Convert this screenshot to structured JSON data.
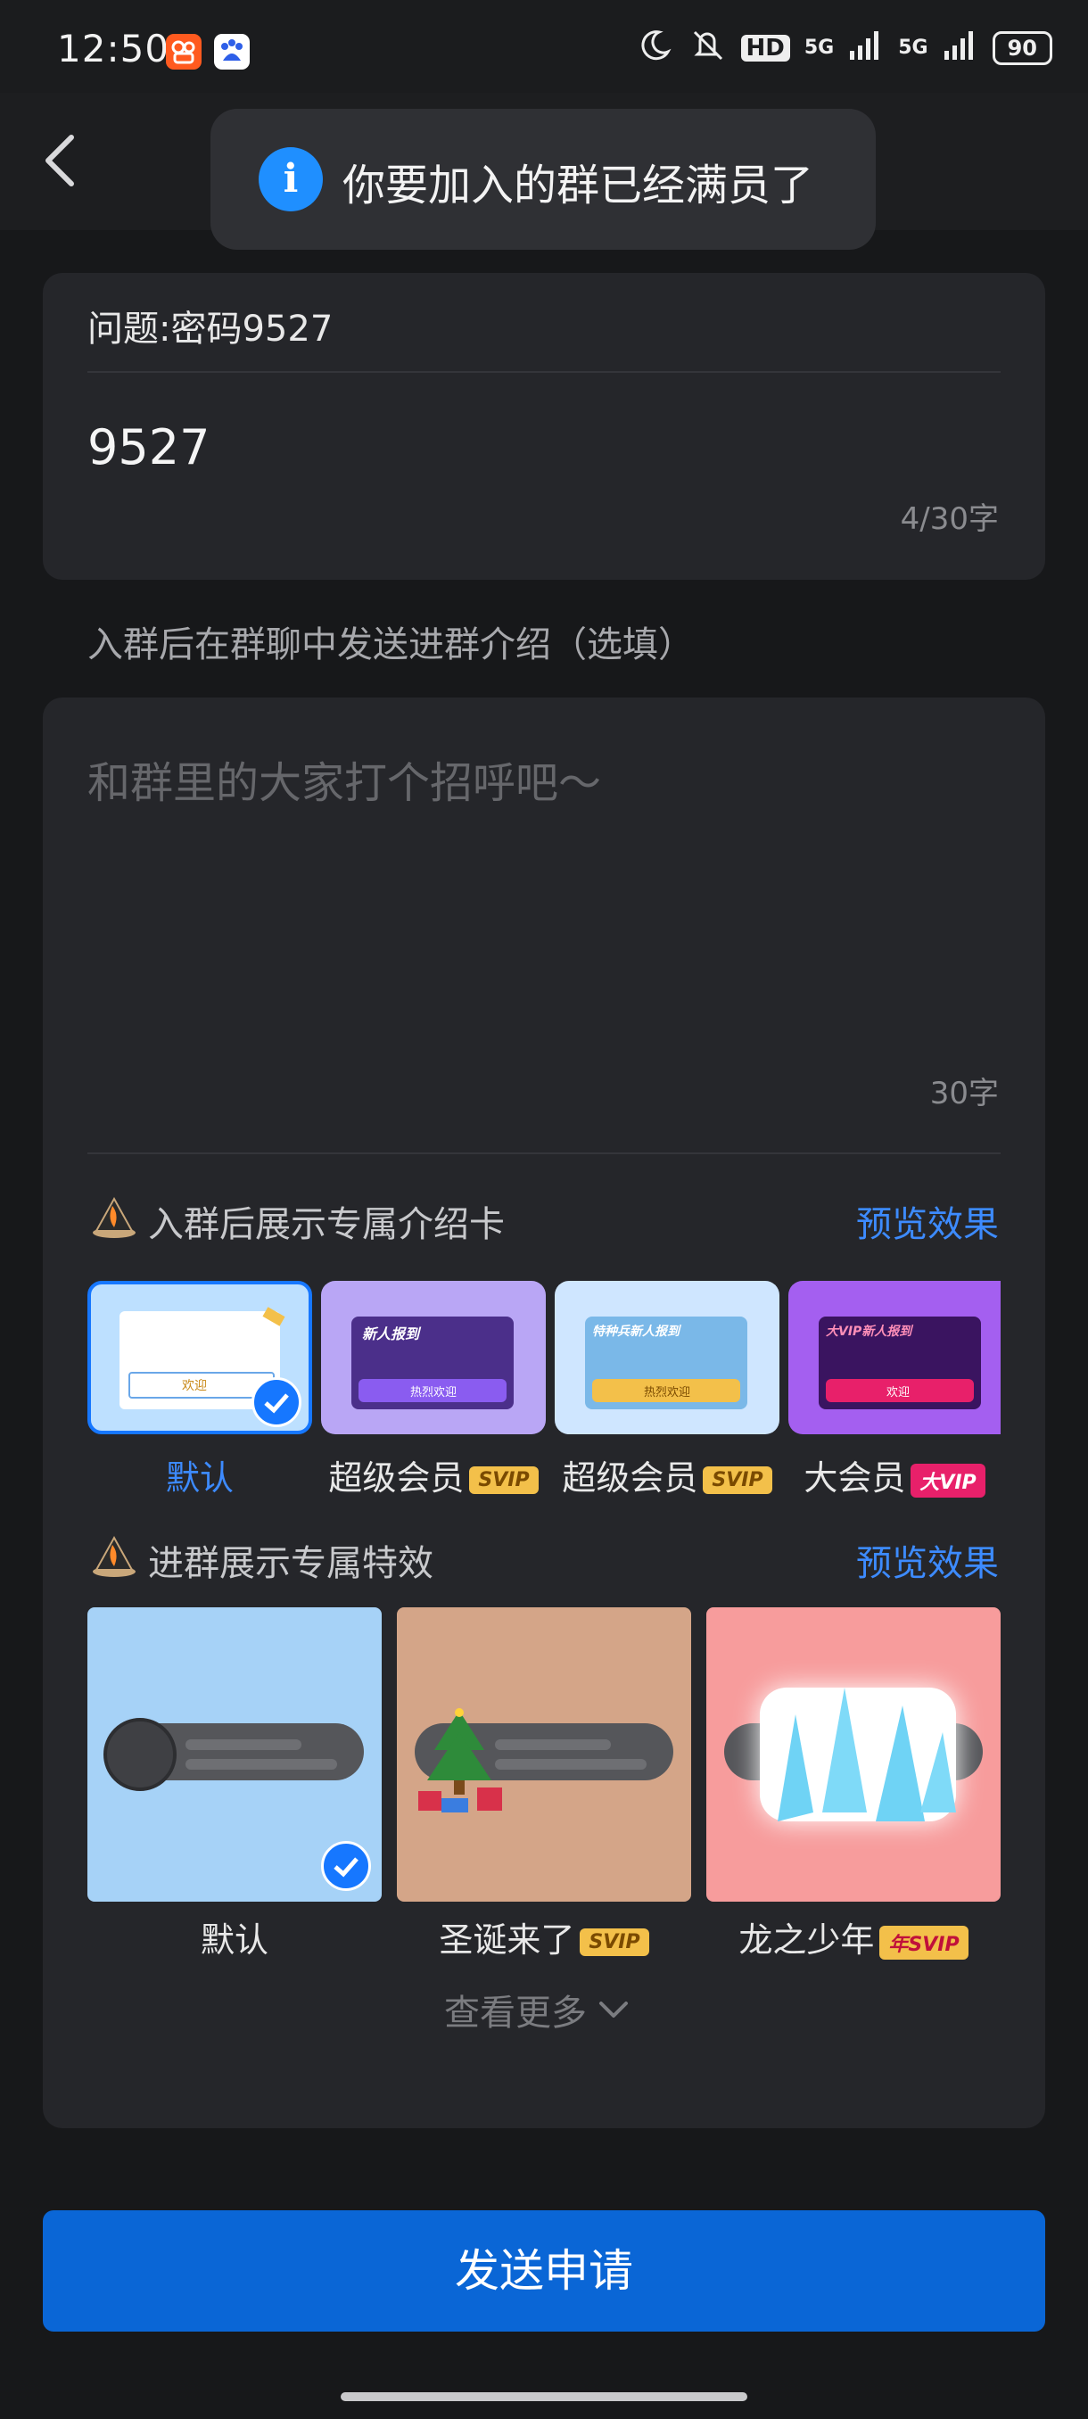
{
  "status_bar": {
    "time": "12:50",
    "network_hd": "HD",
    "network_5g_1": "5G",
    "network_5g_2": "5G",
    "battery": "90",
    "icons": [
      "kuaishou-app-icon",
      "baidu-app-icon",
      "moon-icon",
      "mute-icon",
      "signal-icon",
      "battery-icon"
    ]
  },
  "toast": {
    "icon": "info-icon",
    "message": "你要加入的群已经满员了"
  },
  "question_card": {
    "question": "问题:密码9527",
    "answer": "9527",
    "char_count": "4/30字"
  },
  "intro_label": "入群后在群聊中发送进群介绍（选填）",
  "intro_card": {
    "placeholder": "和群里的大家打个招呼吧～",
    "char_count": "30字"
  },
  "intro_card_section": {
    "title": "入群后展示专属介绍卡",
    "preview_label": "预览效果",
    "cards": [
      {
        "label": "默认",
        "badge": "",
        "selected": true
      },
      {
        "label": "超级会员",
        "badge": "SVIP"
      },
      {
        "label": "超级会员",
        "badge": "SVIP"
      },
      {
        "label": "大会员",
        "badge": "大VIP"
      }
    ],
    "card_texts": {
      "default_welcome": "欢迎",
      "card2_title": "新人报到",
      "card2_button": "热烈欢迎",
      "card3_title": "特种兵新人报到",
      "card3_button": "热烈欢迎",
      "card4_title": "大VIP新人报到",
      "card4_button": "欢迎"
    }
  },
  "effect_section": {
    "title": "进群展示专属特效",
    "preview_label": "预览效果",
    "effects": [
      {
        "label": "默认",
        "badge": "",
        "selected": true
      },
      {
        "label": "圣诞来了",
        "badge": "SVIP"
      },
      {
        "label": "龙之少年",
        "badge": "年SVIP"
      }
    ],
    "more_label": "查看更多"
  },
  "send_button": "发送申请",
  "colors": {
    "accent": "#1677ff",
    "send_button": "#0a66d6",
    "card_bg": "#25262a",
    "svip_badge": "#f3c04a"
  }
}
